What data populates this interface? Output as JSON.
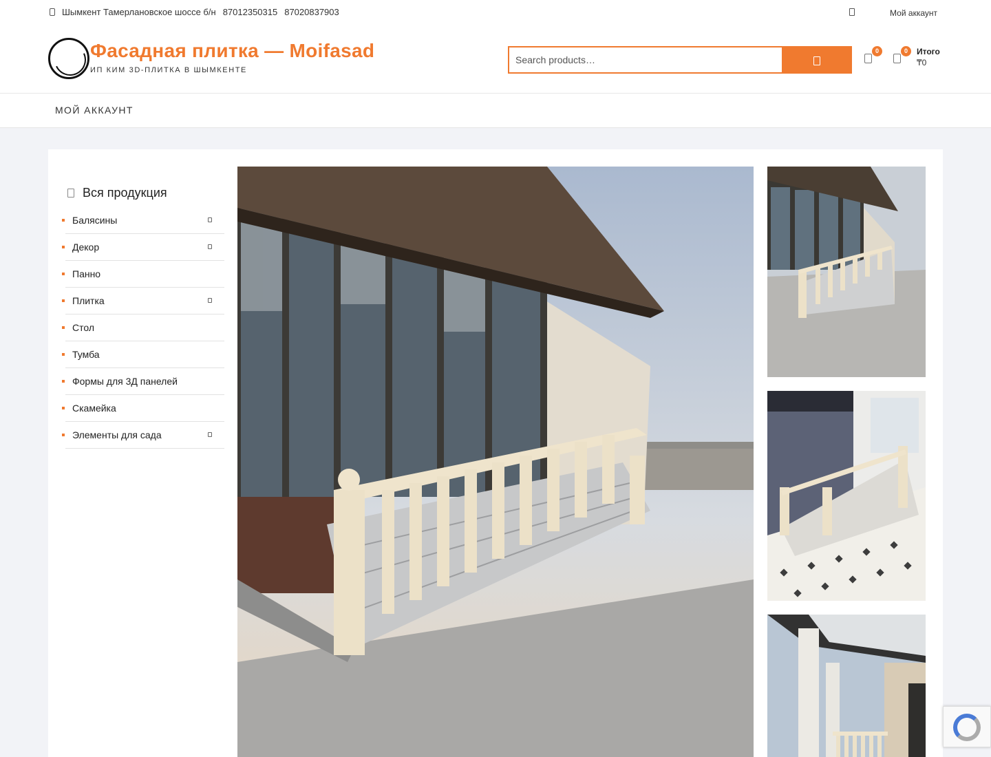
{
  "topbar": {
    "address": "Шымкент Тамерлановское шоссе б/н",
    "phone1": "87012350315",
    "phone2": "87020837903",
    "account_link": "Мой аккаунт"
  },
  "header": {
    "site_title": "Фасадная плитка — Moifasad",
    "site_description": "ИП КИМ 3D-ПЛИТКА В ШЫМКЕНТЕ",
    "search_placeholder": "Search products…",
    "wishlist_count": "0",
    "cart_count": "0",
    "cart_total_label": "Итого",
    "cart_total_value": "₸0"
  },
  "nav": {
    "items": [
      {
        "label": "Мой аккаунт"
      }
    ]
  },
  "sidebar": {
    "title": "Вся продукция",
    "categories": [
      {
        "label": "Балясины",
        "has_children": true
      },
      {
        "label": "Декор",
        "has_children": true
      },
      {
        "label": "Панно",
        "has_children": false
      },
      {
        "label": "Плитка",
        "has_children": true
      },
      {
        "label": "Стол",
        "has_children": false
      },
      {
        "label": "Тумба",
        "has_children": false
      },
      {
        "label": "Формы для 3Д панелей",
        "has_children": false
      },
      {
        "label": "Скамейка",
        "has_children": false
      },
      {
        "label": "Элементы для сада",
        "has_children": true
      }
    ]
  },
  "colors": {
    "accent": "#f07a2f",
    "page_bg": "#f2f3f7"
  },
  "icons": [
    "phone-icon",
    "user-icon",
    "search-icon",
    "heart-icon",
    "cart-icon",
    "menu-icon",
    "chevron-down-icon"
  ]
}
